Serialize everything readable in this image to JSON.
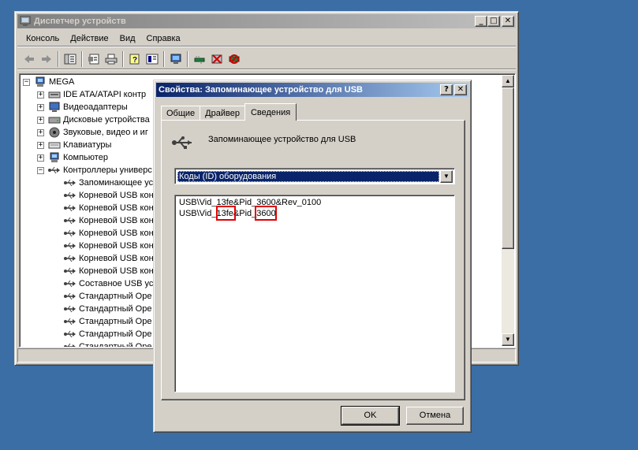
{
  "device_manager": {
    "title": "Диспетчер устройств",
    "window_buttons": {
      "minimize": "_",
      "maximize": "□",
      "close": "✕"
    },
    "menu": [
      "Консоль",
      "Действие",
      "Вид",
      "Справка"
    ],
    "toolbar_icons": [
      "back-icon",
      "forward-icon",
      "console-tree-icon",
      "properties-icon",
      "print-icon",
      "help-icon",
      "view-icon",
      "scan-hardware-icon",
      "update-driver-icon",
      "uninstall-icon",
      "disable-icon"
    ],
    "tree": {
      "root": "MEGA",
      "items": [
        {
          "label": "IDE ATA/ATAPI контр",
          "expander": "+",
          "level": 1,
          "icon": "ide-icon"
        },
        {
          "label": "Видеоадаптеры",
          "expander": "+",
          "level": 1,
          "icon": "display-icon"
        },
        {
          "label": "Дисковые устройства",
          "expander": "+",
          "level": 1,
          "icon": "disk-icon"
        },
        {
          "label": "Звуковые, видео и иг",
          "expander": "+",
          "level": 1,
          "icon": "sound-icon"
        },
        {
          "label": "Клавиатуры",
          "expander": "+",
          "level": 1,
          "icon": "keyboard-icon"
        },
        {
          "label": "Компьютер",
          "expander": "+",
          "level": 1,
          "icon": "computer-icon"
        },
        {
          "label": "Контроллеры универс",
          "expander": "−",
          "level": 1,
          "icon": "usb-icon"
        },
        {
          "label": "Запоминающее уст",
          "level": 2,
          "icon": "usb-icon"
        },
        {
          "label": "Корневой USB кон",
          "level": 2,
          "icon": "usb-icon"
        },
        {
          "label": "Корневой USB кон",
          "level": 2,
          "icon": "usb-icon"
        },
        {
          "label": "Корневой USB кон",
          "level": 2,
          "icon": "usb-icon"
        },
        {
          "label": "Корневой USB кон",
          "level": 2,
          "icon": "usb-icon"
        },
        {
          "label": "Корневой USB кон",
          "level": 2,
          "icon": "usb-icon"
        },
        {
          "label": "Корневой USB кон",
          "level": 2,
          "icon": "usb-icon"
        },
        {
          "label": "Корневой USB кон",
          "level": 2,
          "icon": "usb-icon"
        },
        {
          "label": "Составное USB уст",
          "level": 2,
          "icon": "usb-icon"
        },
        {
          "label": "Стандартный Оре",
          "level": 2,
          "icon": "usb-icon"
        },
        {
          "label": "Стандартный Оре",
          "level": 2,
          "icon": "usb-icon"
        },
        {
          "label": "Стандартный Оре",
          "level": 2,
          "icon": "usb-icon"
        },
        {
          "label": "Стандартный Оре",
          "level": 2,
          "icon": "usb-icon"
        },
        {
          "label": "Стандартный Оре",
          "level": 2,
          "icon": "usb-icon"
        }
      ]
    },
    "scroll_arrows": {
      "up": "▲",
      "down": "▼"
    }
  },
  "properties_dialog": {
    "title": "Свойства: Запоминающее устройство для USB",
    "window_buttons": {
      "help": "?",
      "close": "✕"
    },
    "tabs": [
      "Общие",
      "Драйвер",
      "Сведения"
    ],
    "active_tab": "Сведения",
    "device_name": "Запоминающее устройство для USB",
    "property_select": {
      "selected": "Коды (ID) оборудования",
      "arrow": "▼"
    },
    "values": [
      "USB\\Vid_13fe&Pid_3600&Rev_0100",
      "USB\\Vid_13fe&Pid_3600"
    ],
    "highlight_color": "#e00000",
    "ok_label": "OK",
    "cancel_label": "Отмена"
  }
}
